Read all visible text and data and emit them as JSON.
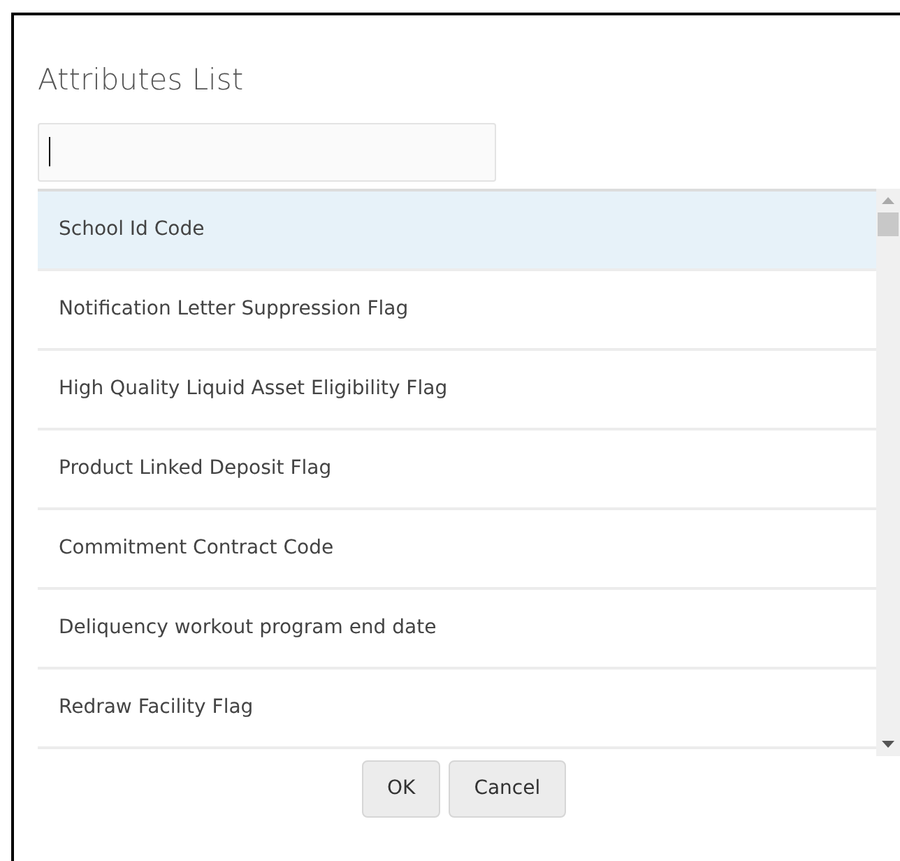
{
  "dialog": {
    "title": "Attributes List"
  },
  "items": [
    {
      "label": "School Id Code",
      "selected": true
    },
    {
      "label": "Notification Letter Suppression Flag",
      "selected": false
    },
    {
      "label": "High Quality Liquid Asset Eligibility Flag",
      "selected": false
    },
    {
      "label": "Product Linked Deposit Flag",
      "selected": false
    },
    {
      "label": "Commitment Contract Code",
      "selected": false
    },
    {
      "label": "Deliquency workout program end date",
      "selected": false
    },
    {
      "label": "Redraw Facility Flag",
      "selected": false
    }
  ],
  "buttons": [
    "OK",
    "Cancel"
  ]
}
